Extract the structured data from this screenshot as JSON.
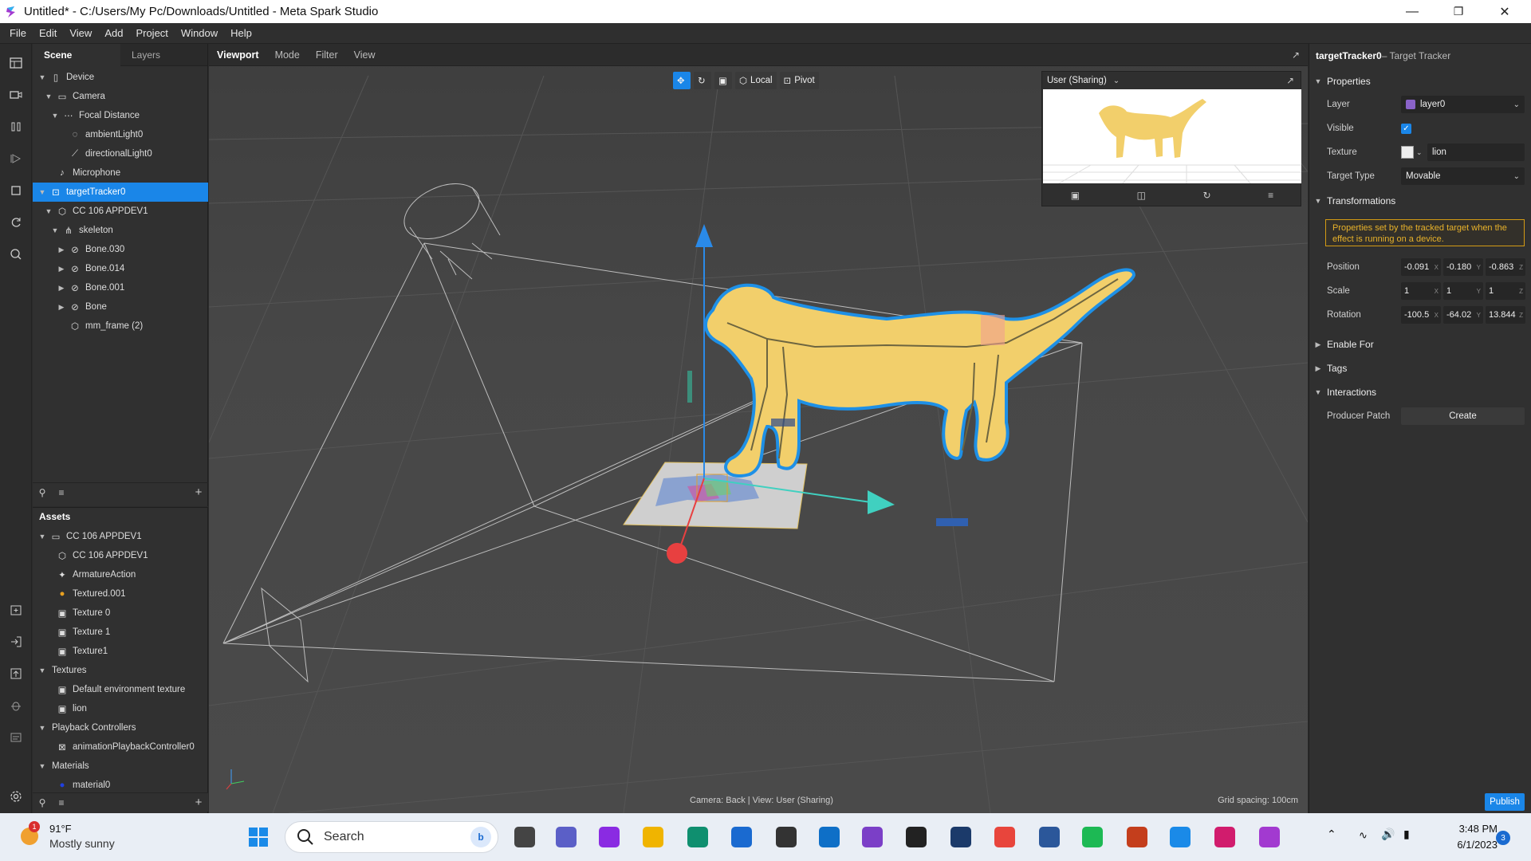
{
  "window": {
    "title": "Untitled* - C:/Users/My Pc/Downloads/Untitled - Meta Spark Studio",
    "minimize": "—",
    "restore": "❐",
    "close": "✕"
  },
  "menu": [
    "File",
    "Edit",
    "View",
    "Add",
    "Project",
    "Window",
    "Help"
  ],
  "scene_panel": {
    "tabs": [
      "Scene",
      "Layers"
    ],
    "tree": [
      {
        "label": "Device",
        "icon": "device-icon",
        "depth": 0,
        "arrow": "▼"
      },
      {
        "label": "Camera",
        "icon": "camera-icon",
        "depth": 1,
        "arrow": "▼"
      },
      {
        "label": "Focal Distance",
        "icon": "focal-distance-icon",
        "depth": 2,
        "arrow": "▼"
      },
      {
        "label": "ambientLight0",
        "icon": "ambient-light-icon",
        "depth": 3,
        "arrow": ""
      },
      {
        "label": "directionalLight0",
        "icon": "directional-light-icon",
        "depth": 3,
        "arrow": ""
      },
      {
        "label": "Microphone",
        "icon": "microphone-icon",
        "depth": 1,
        "arrow": ""
      },
      {
        "label": "targetTracker0",
        "icon": "target-tracker-icon",
        "depth": 0,
        "arrow": "▼",
        "selected": true
      },
      {
        "label": "CC 106 APPDEV1",
        "icon": "mesh-icon",
        "depth": 1,
        "arrow": "▼"
      },
      {
        "label": "skeleton",
        "icon": "skeleton-icon",
        "depth": 2,
        "arrow": "▼"
      },
      {
        "label": "Bone.030",
        "icon": "bone-icon",
        "depth": 3,
        "arrow": "▶"
      },
      {
        "label": "Bone.014",
        "icon": "bone-icon",
        "depth": 3,
        "arrow": "▶"
      },
      {
        "label": "Bone.001",
        "icon": "bone-icon",
        "depth": 3,
        "arrow": "▶"
      },
      {
        "label": "Bone",
        "icon": "bone-icon",
        "depth": 3,
        "arrow": "▶"
      },
      {
        "label": "mm_frame (2)",
        "icon": "mesh-icon",
        "depth": 3,
        "arrow": ""
      }
    ]
  },
  "assets_panel": {
    "title": "Assets",
    "tree": [
      {
        "label": "CC 106 APPDEV1",
        "icon": "folder-icon",
        "depth": 0,
        "arrow": "▼"
      },
      {
        "label": "CC 106 APPDEV1",
        "icon": "mesh-icon",
        "depth": 1,
        "arrow": ""
      },
      {
        "label": "ArmatureAction",
        "icon": "animation-icon",
        "depth": 1,
        "arrow": ""
      },
      {
        "label": "Textured.001",
        "icon": "material-icon",
        "depth": 1,
        "arrow": ""
      },
      {
        "label": "Texture 0",
        "icon": "texture-icon",
        "depth": 1,
        "arrow": ""
      },
      {
        "label": "Texture 1",
        "icon": "texture-icon",
        "depth": 1,
        "arrow": ""
      },
      {
        "label": "Texture1",
        "icon": "texture-icon",
        "depth": 1,
        "arrow": ""
      },
      {
        "label": "Textures",
        "icon": "",
        "depth": 0,
        "arrow": "▼"
      },
      {
        "label": "Default environment texture",
        "icon": "texture-icon",
        "depth": 1,
        "arrow": ""
      },
      {
        "label": "lion",
        "icon": "texture-icon",
        "depth": 1,
        "arrow": ""
      },
      {
        "label": "Playback Controllers",
        "icon": "",
        "depth": 0,
        "arrow": "▼"
      },
      {
        "label": "animationPlaybackController0",
        "icon": "playback-controller-icon",
        "depth": 1,
        "arrow": ""
      },
      {
        "label": "Materials",
        "icon": "",
        "depth": 0,
        "arrow": "▼"
      },
      {
        "label": "material0",
        "icon": "material-icon",
        "depth": 1,
        "arrow": ""
      }
    ]
  },
  "viewport": {
    "tabs": [
      "Viewport",
      "Mode",
      "Filter",
      "View"
    ],
    "toolbar": {
      "local": "Local",
      "pivot": "Pivot"
    },
    "status_left": "Camera: Back | View: User (Sharing)",
    "status_right": "Grid spacing: 100cm",
    "preview_title": "User (Sharing)"
  },
  "inspector": {
    "object_name": "targetTracker0",
    "object_type": " – Target Tracker",
    "sections": {
      "properties": "Properties",
      "transformations": "Transformations",
      "enable_for": "Enable For",
      "tags": "Tags",
      "interactions": "Interactions"
    },
    "layer": {
      "label": "Layer",
      "value": "layer0",
      "color": "#8a63c9"
    },
    "visible": {
      "label": "Visible",
      "checked": true
    },
    "texture": {
      "label": "Texture",
      "value": "lion"
    },
    "target_type": {
      "label": "Target Type",
      "value": "Movable"
    },
    "notice": "Properties set by the tracked target when the effect is running on a device.",
    "position": {
      "label": "Position",
      "x": "-0.091",
      "y": "-0.180",
      "z": "-0.863"
    },
    "scale": {
      "label": "Scale",
      "x": "1",
      "y": "1",
      "z": "1"
    },
    "rotation": {
      "label": "Rotation",
      "x": "-100.5",
      "y": "-64.02",
      "z": "13.844"
    },
    "axes": {
      "x": "X",
      "y": "Y",
      "z": "Z"
    },
    "producer_patch": {
      "label": "Producer Patch",
      "button": "Create"
    },
    "publish": "Publish"
  },
  "taskbar": {
    "temp": "91°F",
    "weather": "Mostly sunny",
    "weather_badge": "1",
    "search_placeholder": "Search",
    "time": "3:48 PM",
    "date": "6/1/2023",
    "notifications": "3",
    "apps": [
      "start-icon",
      "task-view-icon",
      "teams-chat-icon",
      "winrar-icon",
      "file-explorer-icon",
      "edge-icon",
      "store-icon",
      "unity-icon",
      "vscode-icon",
      "visual-studio-icon",
      "app-icon",
      "lightroom-icon",
      "chrome-icon",
      "word-icon",
      "spotify-icon",
      "powerpoint-icon",
      "photos-icon",
      "jetbrains-icon",
      "spark-studio-icon"
    ]
  },
  "colors": {
    "accent": "#1a86e8",
    "selection": "#1a86e8",
    "lion": "#f2cf6b",
    "outline": "#1e90e6",
    "notice": "#d49b14"
  }
}
